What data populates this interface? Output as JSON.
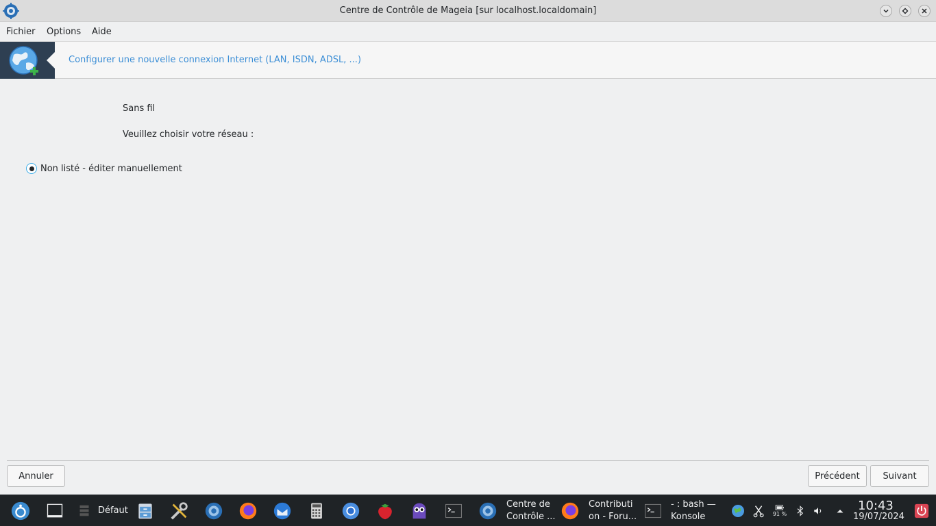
{
  "window": {
    "title": "Centre de Contrôle de Mageia [sur localhost.localdomain]"
  },
  "menubar": {
    "items": [
      "Fichier",
      "Options",
      "Aide"
    ]
  },
  "banner": {
    "text": "Configurer une nouvelle connexion Internet (LAN, ISDN, ADSL, ...)",
    "icon": "globe-plus-icon"
  },
  "content": {
    "connection_type": "Sans fil",
    "prompt": "Veuillez choisir votre réseau :",
    "networks": [
      {
        "label": "Non listé - éditer manuellement",
        "selected": true
      }
    ]
  },
  "buttons": {
    "cancel": "Annuler",
    "previous": "Précédent",
    "next": "Suivant"
  },
  "taskbar": {
    "desktop_label": "Défaut",
    "tasks": [
      {
        "label": "Centre de Contrôle ...",
        "line1": "Centre de",
        "line2": "Contrôle ..."
      },
      {
        "label": "Contribution - Foru...",
        "line1": "Contributi",
        "line2": "on - Foru..."
      },
      {
        "label": "- : bash — Konsole",
        "line1": "- : bash —",
        "line2": "Konsole"
      }
    ],
    "battery_percent": "91 %",
    "clock_time": "10:43",
    "clock_date": "19/07/2024"
  },
  "colors": {
    "accent": "#3daee9",
    "banner_link": "#3d8fd6",
    "taskbar_bg": "#1f2326",
    "window_bg": "#eff0f1"
  }
}
